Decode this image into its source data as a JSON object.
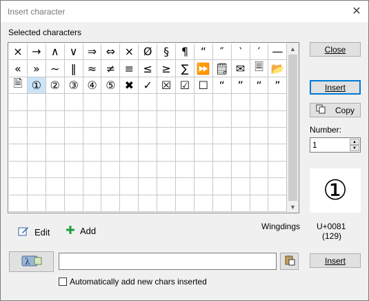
{
  "window": {
    "title": "Insert character",
    "close_icon": "✕"
  },
  "selected_label": "Selected characters",
  "grid": {
    "rows": [
      [
        "×",
        "→",
        "∧",
        "∨",
        "⇒",
        "⇔",
        "×",
        "Ø",
        "§",
        "¶",
        "“",
        "″",
        "‵",
        "′",
        "—"
      ],
      [
        "«",
        "»",
        "∼",
        "‖",
        "≈",
        "≠",
        "≡",
        "≤",
        "≥",
        "∑",
        "⏩",
        "🗒",
        "✉",
        "🗏",
        "📂"
      ],
      [
        "🗎",
        "①",
        "②",
        "③",
        "④",
        "⑤",
        "✖",
        "✓",
        "☒",
        "☑",
        "☐",
        "“",
        "”",
        "“",
        "”"
      ],
      [
        "",
        "",
        "",
        "",
        "",
        "",
        "",
        "",
        "",
        "",
        "",
        "",
        "",
        "",
        ""
      ],
      [
        "",
        "",
        "",
        "",
        "",
        "",
        "",
        "",
        "",
        "",
        "",
        "",
        "",
        "",
        ""
      ],
      [
        "",
        "",
        "",
        "",
        "",
        "",
        "",
        "",
        "",
        "",
        "",
        "",
        "",
        "",
        ""
      ],
      [
        "",
        "",
        "",
        "",
        "",
        "",
        "",
        "",
        "",
        "",
        "",
        "",
        "",
        "",
        ""
      ],
      [
        "",
        "",
        "",
        "",
        "",
        "",
        "",
        "",
        "",
        "",
        "",
        "",
        "",
        "",
        ""
      ],
      [
        "",
        "",
        "",
        "",
        "",
        "",
        "",
        "",
        "",
        "",
        "",
        "",
        "",
        "",
        ""
      ],
      [
        "",
        "",
        "",
        "",
        "",
        "",
        "",
        "",
        "",
        "",
        "",
        "",
        "",
        "",
        ""
      ]
    ],
    "selected_row": 2,
    "selected_col": 1
  },
  "buttons": {
    "close": "Close",
    "insert_top": "Insert",
    "copy": "Copy",
    "insert_bottom": "Insert"
  },
  "number": {
    "label": "Number:",
    "value": "1"
  },
  "preview_char": "①",
  "font_name": "Wingdings",
  "code": {
    "hex": "U+0081",
    "dec": "(129)"
  },
  "tools": {
    "edit": "Edit",
    "add": "Add"
  },
  "input": {
    "value": ""
  },
  "checkbox": {
    "label": "Automatically add new chars inserted",
    "checked": false
  }
}
